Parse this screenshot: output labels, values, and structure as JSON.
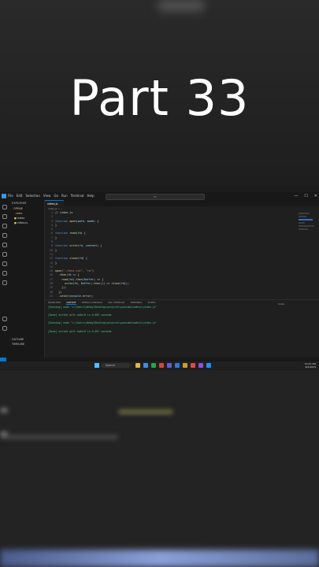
{
  "title": "Part 33",
  "window": {
    "menu": [
      "File",
      "Edit",
      "Selection",
      "View",
      "Go",
      "Run",
      "Terminal",
      "Help"
    ],
    "search_placeholder": "Fs",
    "controls": [
      "—",
      "☐",
      "✕"
    ]
  },
  "explorer": {
    "header": "EXPLORER",
    "items": [
      {
        "type": "folder",
        "label": "OPENE"
      },
      {
        "type": "folder",
        "label": "cstrs"
      },
      {
        "type": "file",
        "label": "index"
      },
      {
        "type": "file",
        "label": "video.js"
      }
    ],
    "bottom": [
      "OUTLINE",
      "TIMELINE"
    ]
  },
  "editor": {
    "tab_label": "video.js",
    "breadcrumb": "video.js > ...",
    "code_lines": [
      {
        "n": "1",
        "text": "// video.js"
      },
      {
        "n": "2",
        "text": ""
      },
      {
        "n": "3",
        "text": "function open(path, mode) {"
      },
      {
        "n": "4",
        "text": "}"
      },
      {
        "n": "5",
        "text": ""
      },
      {
        "n": "6",
        "text": "function read(fd) {"
      },
      {
        "n": "7",
        "text": "}"
      },
      {
        "n": "8",
        "text": ""
      },
      {
        "n": "9",
        "text": "function write(fd, content) {"
      },
      {
        "n": "10",
        "text": "}"
      },
      {
        "n": "11",
        "text": ""
      },
      {
        "n": "12",
        "text": "function close(fd) {"
      },
      {
        "n": "13",
        "text": "}"
      },
      {
        "n": "14",
        "text": ""
      },
      {
        "n": "15",
        "text": "open(\"./test.txt\", \"rw\")"
      },
      {
        "n": "16",
        "text": "  .then(fd => {"
      },
      {
        "n": "17",
        "text": "    read(fd).then(Buffer) => {"
      },
      {
        "n": "18",
        "text": "      write(fd, Buffer).then(() => close(fd));"
      },
      {
        "n": "19",
        "text": "    });"
      },
      {
        "n": "20",
        "text": "  })"
      },
      {
        "n": "21",
        "text": "  .catch(console.error);"
      }
    ]
  },
  "panel": {
    "tabs": [
      "PROBLEMS",
      "OUTPUT",
      "DEBUG CONSOLE",
      "SQL CONSOLE",
      "TERMINAL",
      "PORTS"
    ],
    "active_tab": "OUTPUT",
    "channel": "Code",
    "output": [
      {
        "kind": "running",
        "text": "[Running] node \"c:\\Users\\Abhay\\Desktop\\projects\\youtube\\nodejs\\video.js\""
      },
      {
        "kind": "plain",
        "text": ""
      },
      {
        "kind": "done",
        "text": "[Done] exited with code=0 in 0.053 seconds"
      },
      {
        "kind": "plain",
        "text": ""
      },
      {
        "kind": "running",
        "text": "[Running] node \"c:\\Users\\Abhay\\Desktop\\projects\\youtube\\nodejs\\video.js\""
      },
      {
        "kind": "plain",
        "text": ""
      },
      {
        "kind": "done",
        "text": "[Done] exited with code=0 in 0.057 seconds"
      }
    ]
  },
  "taskbar": {
    "search": "Search",
    "time": "10:21 AM",
    "date": "6/2/2024"
  },
  "colors": {
    "accent": "#0078d4",
    "keyword": "#569cd6",
    "function": "#dcdcaa",
    "string": "#ce9178",
    "success": "#3ecf8e"
  }
}
